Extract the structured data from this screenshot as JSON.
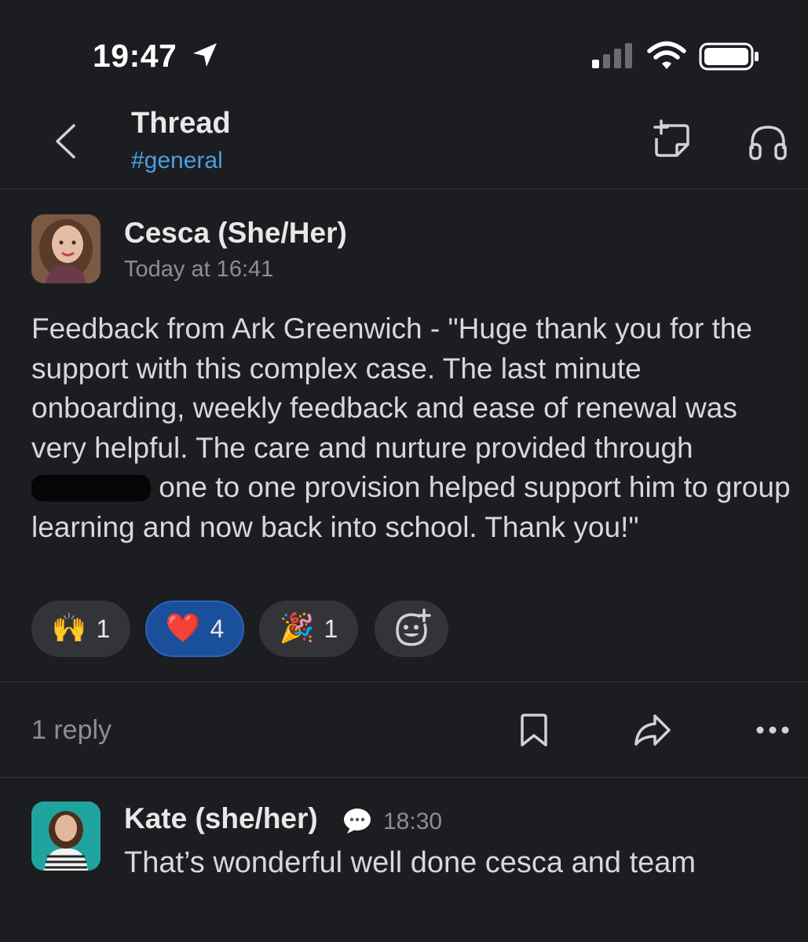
{
  "status_bar": {
    "time": "19:47",
    "location_icon": "location-arrow-icon",
    "signal_icon": "cellular-signal-icon",
    "wifi_icon": "wifi-icon",
    "battery_icon": "battery-icon"
  },
  "header": {
    "back_icon": "chevron-left-icon",
    "title": "Thread",
    "channel": "#general",
    "note_icon": "add-canvas-icon",
    "huddle_icon": "headphones-icon"
  },
  "message": {
    "author": "Cesca (She/Her)",
    "timestamp": "Today at 16:41",
    "text_part1": "Feedback from Ark Greenwich - \"Huge thank you for the support with this complex case. The last minute onboarding, weekly feedback and ease of renewal was very helpful. The care and nurture provided through ",
    "text_part2": " one to one provision helped support him to group learning and now back into school. Thank you!\"",
    "reactions": [
      {
        "emoji": "🙌",
        "count": "1",
        "active": false
      },
      {
        "emoji": "❤️",
        "count": "4",
        "active": true
      },
      {
        "emoji": "🎉",
        "count": "1",
        "active": false
      }
    ],
    "add_reaction_icon": "add-emoji-icon"
  },
  "reply_bar": {
    "reply_count": "1 reply",
    "bookmark_icon": "bookmark-icon",
    "share_icon": "share-icon",
    "more_icon": "more-horizontal-icon"
  },
  "reply": {
    "author": "Kate (she/her)",
    "status_icon": "speech-bubble-icon",
    "time": "18:30",
    "text": "That’s wonderful well done cesca and team"
  },
  "colors": {
    "background": "#1b1d21",
    "link": "#4a9fe0",
    "active_reaction": "#1a4f9c",
    "reaction_bg": "#323438"
  }
}
